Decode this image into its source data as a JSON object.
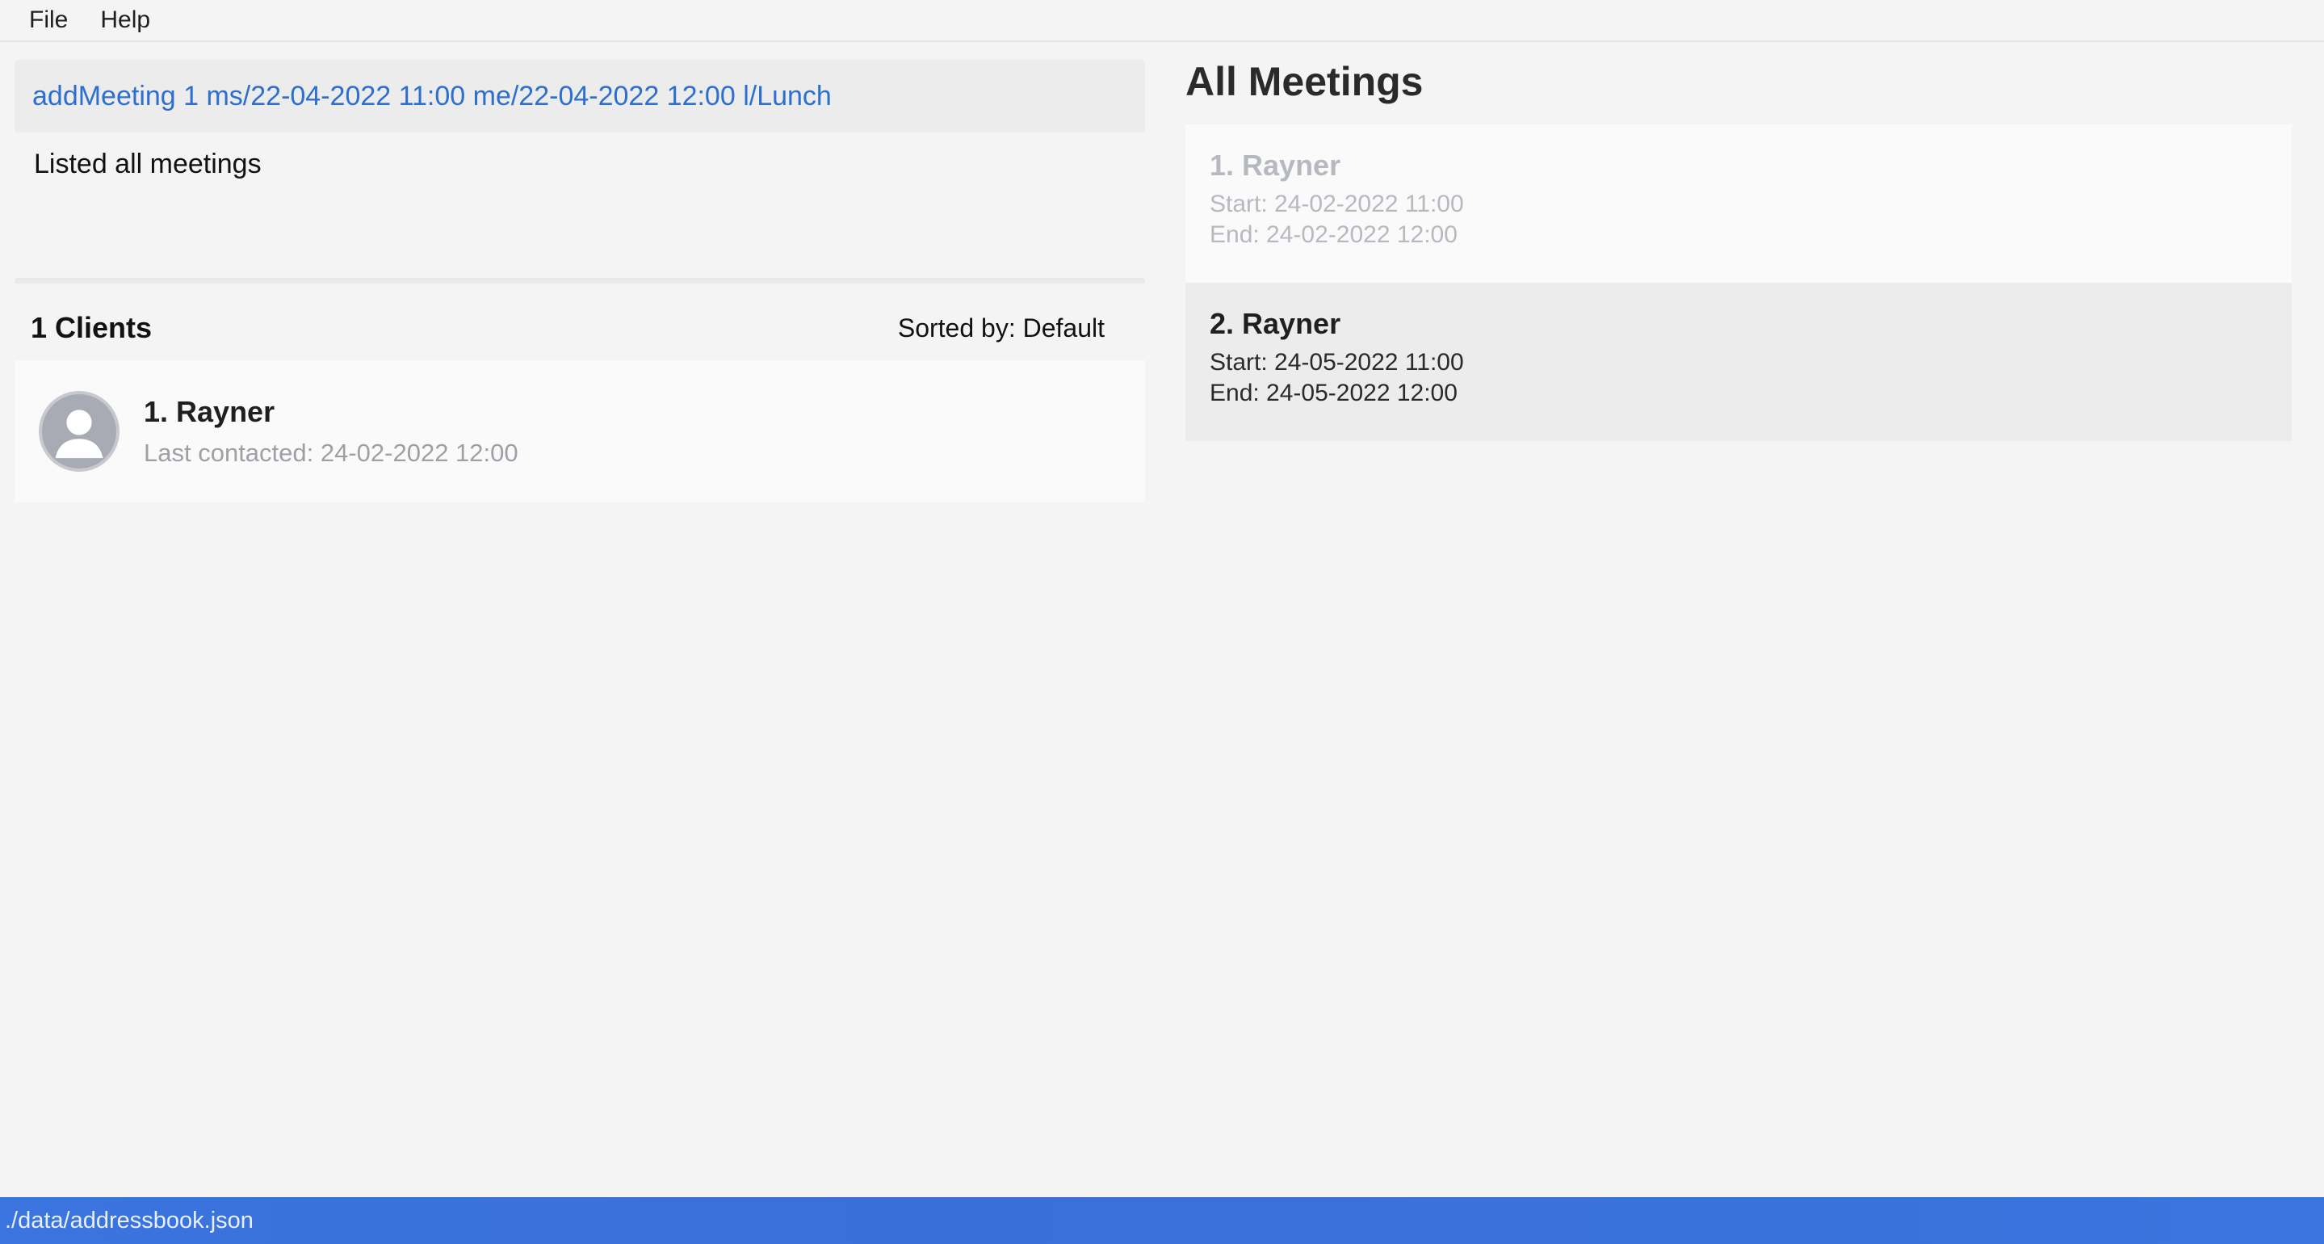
{
  "menu": {
    "file_label": "File",
    "help_label": "Help"
  },
  "command": {
    "text": "addMeeting 1 ms/22-04-2022 11:00 me/22-04-2022 12:00 l/Lunch"
  },
  "result": {
    "message": "Listed all meetings"
  },
  "clients": {
    "count_label": "1 Clients",
    "sorted_label": "Sorted by: Default",
    "items": [
      {
        "name": "1.  Rayner",
        "last_contacted": "Last contacted: 24-02-2022 12:00"
      }
    ]
  },
  "meetings": {
    "title": "All Meetings",
    "items": [
      {
        "title": "1.  Rayner",
        "start": "Start: 24-02-2022 11:00",
        "end": "End: 24-02-2022 12:00"
      },
      {
        "title": "2.  Rayner",
        "start": "Start: 24-05-2022 11:00",
        "end": "End: 24-05-2022 12:00"
      }
    ]
  },
  "status": {
    "path": "./data/addressbook.json"
  },
  "colors": {
    "accent": "#2d6fce",
    "status_bar": "#3a74de",
    "past_meeting_text": "#b7b9c0"
  },
  "icons": {
    "avatar": "user-avatar-icon"
  }
}
